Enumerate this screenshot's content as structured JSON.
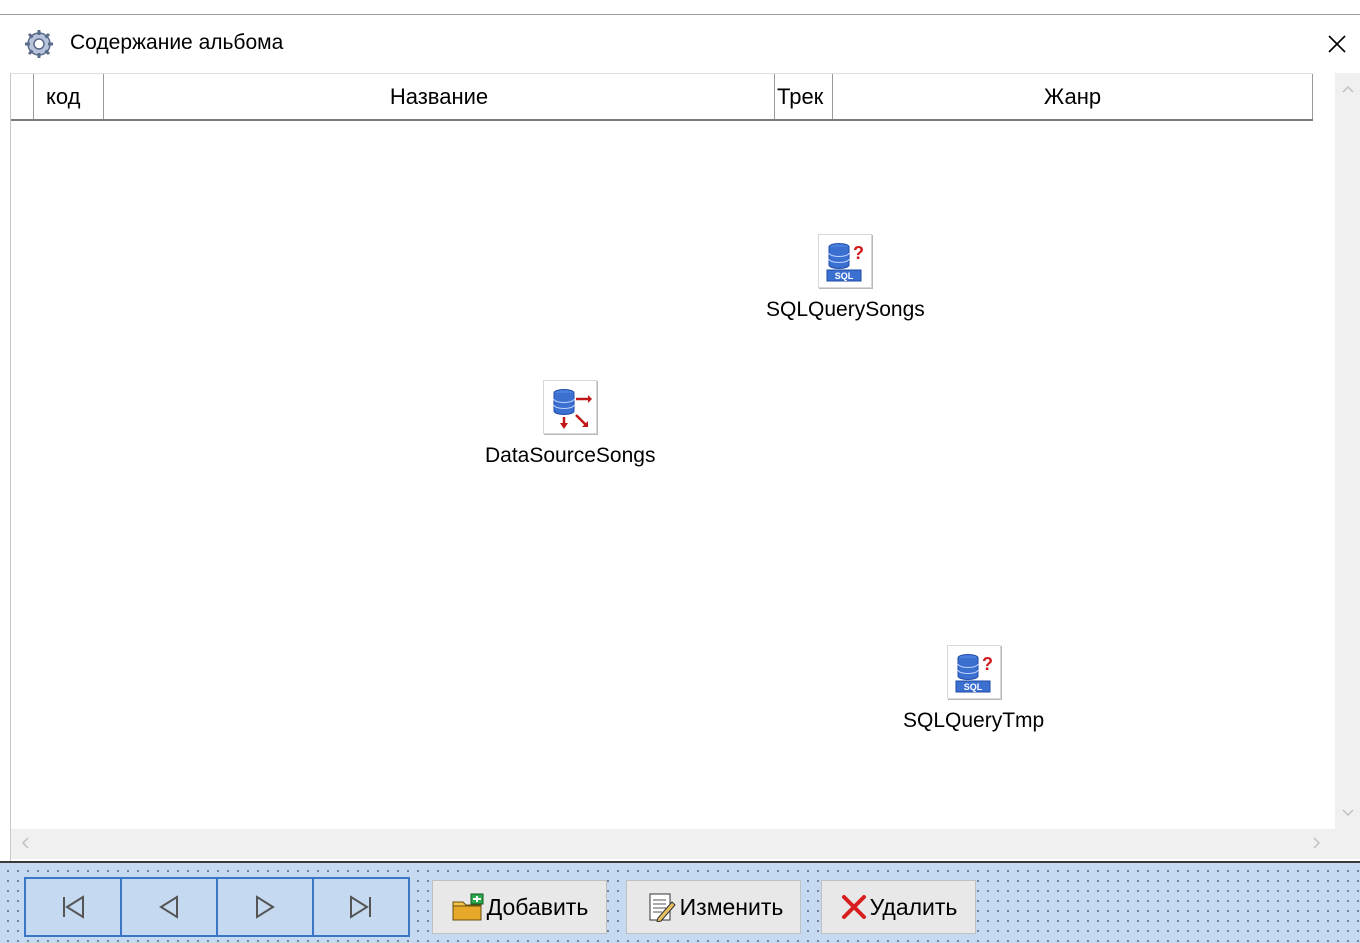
{
  "window": {
    "title": "Содержание альбома"
  },
  "grid": {
    "columns": [
      "код",
      "Название",
      "Трек",
      "Жанр"
    ],
    "rows": []
  },
  "components": [
    {
      "name": "SQLQuerySongs",
      "icon": "sql-query-icon"
    },
    {
      "name": "DataSourceSongs",
      "icon": "datasource-icon"
    },
    {
      "name": "SQLQueryTmp",
      "icon": "sql-query-icon"
    }
  ],
  "navigator": {
    "buttons": [
      "first-record-icon",
      "prior-record-icon",
      "next-record-icon",
      "last-record-icon"
    ]
  },
  "buttons": {
    "add": "Добавить",
    "edit": "Изменить",
    "delete": "Удалить"
  },
  "colors": {
    "panel_bg": "#c5d9f1",
    "navigator_border": "#3a76c5",
    "delete_icon": "#d81e1e",
    "sql_icon_blue": "#3b6fd0",
    "sql_icon_question": "#d01a1a"
  }
}
